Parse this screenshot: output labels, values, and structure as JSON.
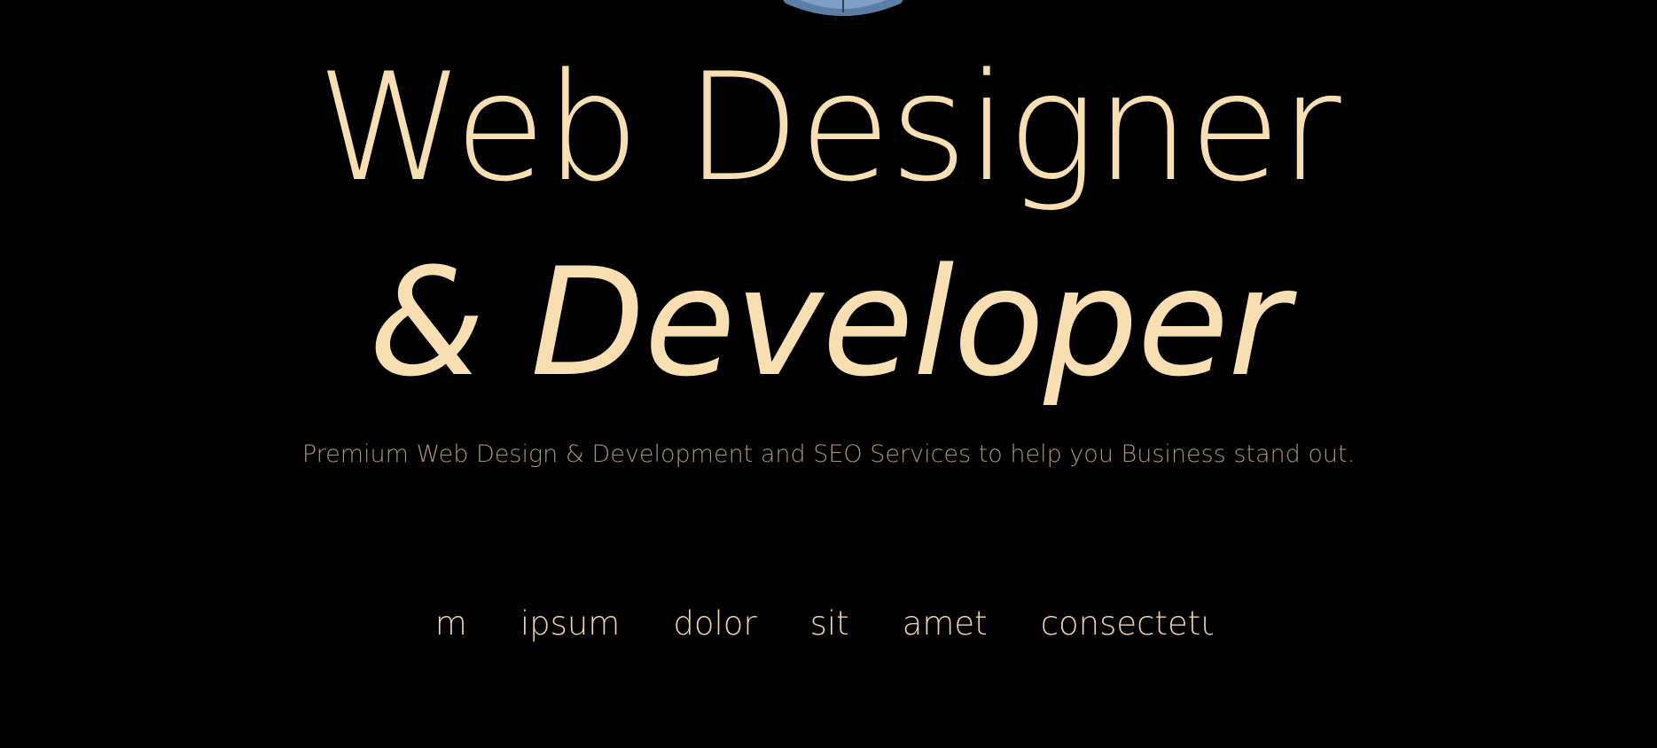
{
  "hero": {
    "photo_icon": "person-photo",
    "headline_line1": "Web Designer",
    "headline_line2": "& Developer",
    "tagline": "Premium Web Design & Development and SEO Services to help you Business stand out."
  },
  "ticker": {
    "words": [
      "em",
      "ipsum",
      "dolor",
      "sit",
      "amet",
      "consectetur"
    ]
  },
  "colors": {
    "background": "#000000",
    "headline": "#f8dfb1",
    "tagline": "#a89677",
    "ticker": "#f0d5a8"
  }
}
